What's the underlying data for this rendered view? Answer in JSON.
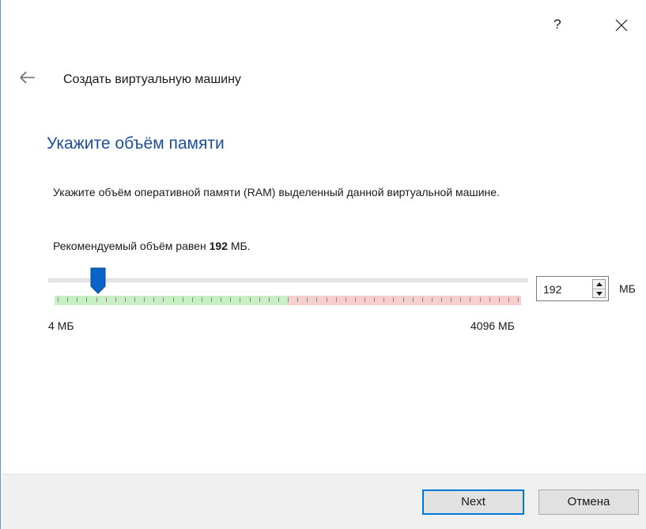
{
  "titlebar": {
    "help_label": "?",
    "close_icon": "close-icon"
  },
  "wizard": {
    "back_icon": "arrow-left-icon",
    "title": "Создать виртуальную машину"
  },
  "page": {
    "heading": "Укажите объём памяти",
    "description": "Укажите объём оперативной памяти (RAM) выделенный данной виртуальной машине.",
    "recommend_prefix": "Рекомендуемый объём равен ",
    "recommend_value": "192",
    "recommend_suffix": " МБ."
  },
  "memory": {
    "min_label": "4 МБ",
    "max_label": "4096 МБ",
    "value": "192",
    "unit": "МБ",
    "min_value": 4,
    "max_value": 4096,
    "recommended_green_max": 2048
  },
  "colors": {
    "accent": "#0078d7",
    "heading": "#1c4d9e",
    "scale_green": "#c9f0c5",
    "scale_red": "#f7cfcc",
    "handle": "#0a64c8"
  },
  "footer": {
    "next_label": "Next",
    "cancel_label": "Отмена"
  }
}
